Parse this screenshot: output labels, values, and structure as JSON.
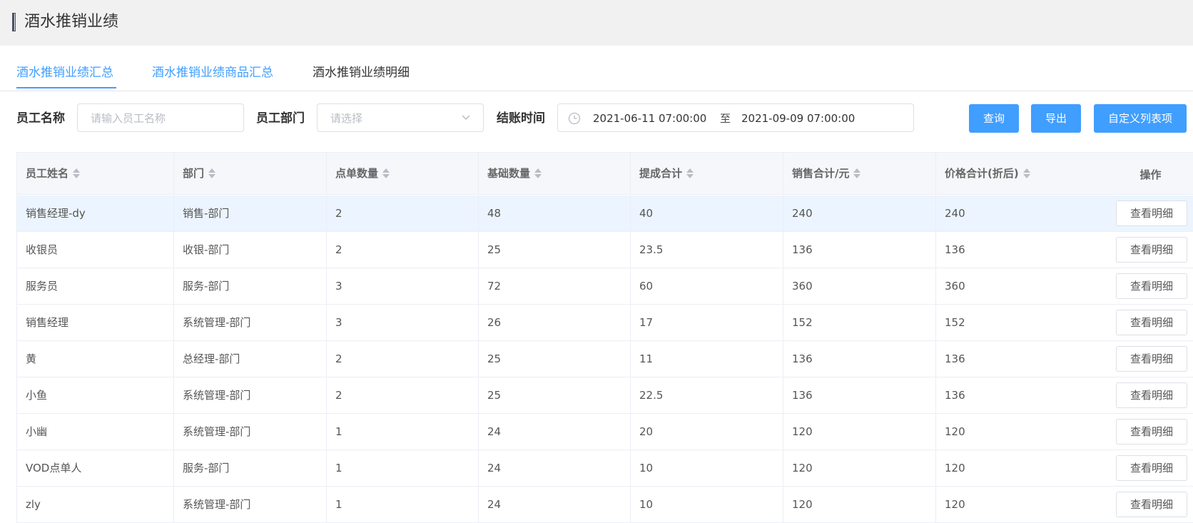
{
  "page": {
    "title": "酒水推销业绩"
  },
  "tabs": [
    {
      "label": "酒水推销业绩汇总",
      "active": true
    },
    {
      "label": "酒水推销业绩商品汇总",
      "active": false
    },
    {
      "label": "酒水推销业绩明细",
      "active": false
    }
  ],
  "filters": {
    "employee_name_label": "员工名称",
    "employee_name_placeholder": "请输入员工名称",
    "department_label": "员工部门",
    "department_placeholder": "请选择",
    "checkout_time_label": "结账时间",
    "start_time": "2021-06-11 07:00:00",
    "range_separator": "至",
    "end_time": "2021-09-09 07:00:00"
  },
  "buttons": {
    "query": "查询",
    "export": "导出",
    "custom_columns": "自定义列表项"
  },
  "table": {
    "headers": [
      "员工姓名",
      "部门",
      "点单数量",
      "基础数量",
      "提成合计",
      "销售合计/元",
      "价格合计(折后)",
      "操作"
    ],
    "action_label": "查看明细",
    "rows": [
      [
        "销售经理-dy",
        "销售-部门",
        "2",
        "48",
        "40",
        "240",
        "240"
      ],
      [
        "收银员",
        "收银-部门",
        "2",
        "25",
        "23.5",
        "136",
        "136"
      ],
      [
        "服务员",
        "服务-部门",
        "3",
        "72",
        "60",
        "360",
        "360"
      ],
      [
        "销售经理",
        "系统管理-部门",
        "3",
        "26",
        "17",
        "152",
        "152"
      ],
      [
        "黄",
        "总经理-部门",
        "2",
        "25",
        "11",
        "136",
        "136"
      ],
      [
        "小鱼",
        "系统管理-部门",
        "2",
        "25",
        "22.5",
        "136",
        "136"
      ],
      [
        "小幽",
        "系统管理-部门",
        "1",
        "24",
        "20",
        "120",
        "120"
      ],
      [
        "VOD点单人",
        "服务-部门",
        "1",
        "24",
        "10",
        "120",
        "120"
      ],
      [
        "zly",
        "系统管理-部门",
        "1",
        "24",
        "10",
        "120",
        "120"
      ]
    ]
  },
  "colors": {
    "accent": "#409eff",
    "header_bg": "#f1f1f1",
    "row_highlight": "#ecf5ff"
  }
}
